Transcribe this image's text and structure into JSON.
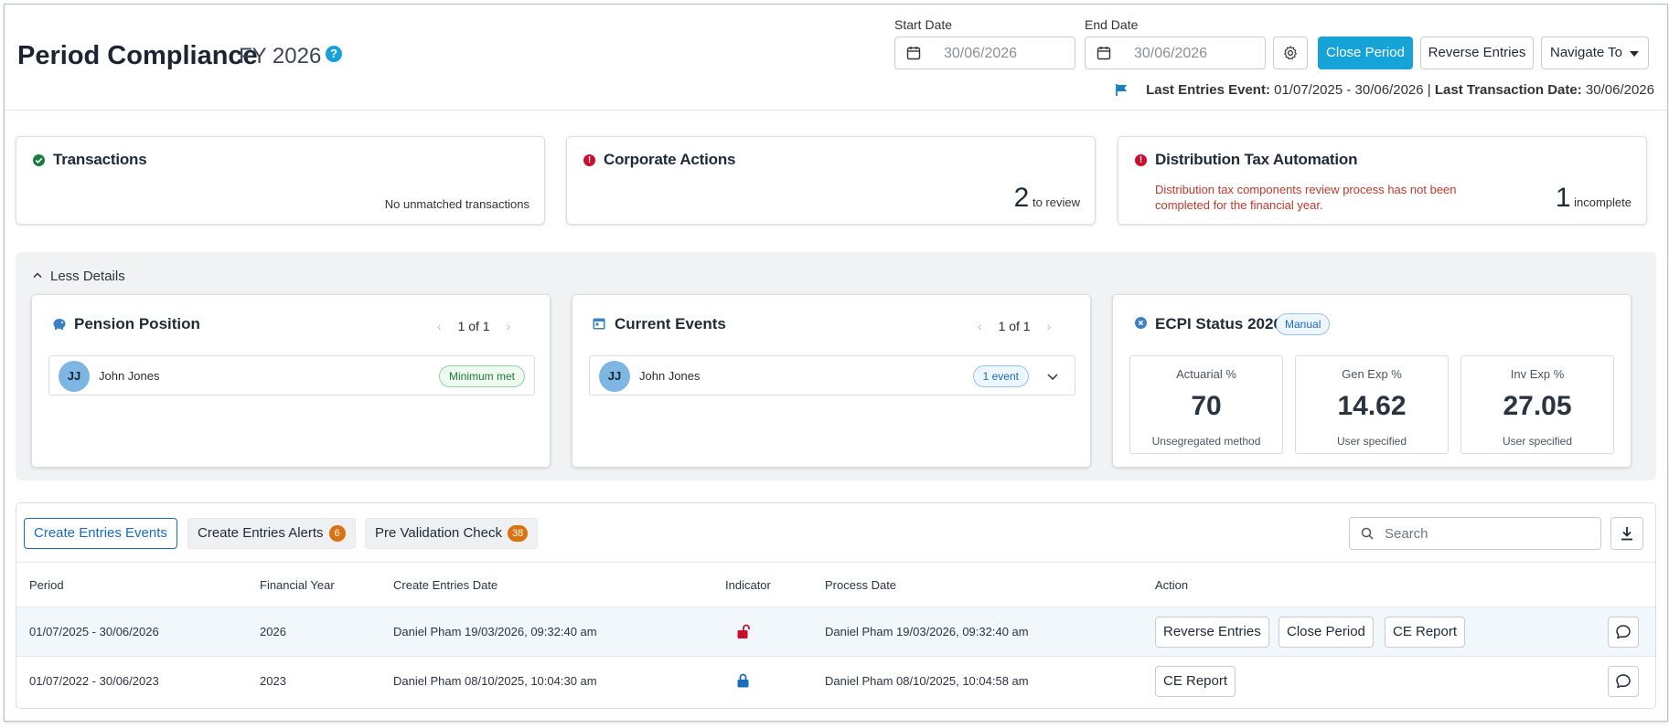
{
  "header": {
    "title": "Period Compliance",
    "subtitle": "FY 2026",
    "help_icon": "?",
    "start_date_label": "Start Date",
    "start_date_value": "30/06/2026",
    "end_date_label": "End Date",
    "end_date_value": "30/06/2026",
    "close_period_label": "Close Period",
    "reverse_entries_label": "Reverse Entries",
    "navigate_to_label": "Navigate To",
    "last_entries_event_label": "Last Entries Event:",
    "last_entries_event_value": "01/07/2025 - 30/06/2026",
    "separator": "|",
    "last_transaction_label": "Last Transaction Date:",
    "last_transaction_value": "30/06/2026"
  },
  "summary": {
    "transactions": {
      "title": "Transactions",
      "status_icon": "check-icon",
      "text": "No unmatched transactions"
    },
    "corporate_actions": {
      "title": "Corporate Actions",
      "status_icon": "alert-icon",
      "count": "2",
      "count_label": "to review"
    },
    "distribution_tax": {
      "title": "Distribution Tax Automation",
      "status_icon": "alert-icon",
      "warning": "Distribution tax components review process has not been completed for the financial year.",
      "count": "1",
      "count_label": "incomplete"
    }
  },
  "details": {
    "toggle_label": "Less Details",
    "pension": {
      "title": "Pension Position",
      "pager": "1 of 1",
      "person_initials": "JJ",
      "person_name": "John Jones",
      "badge": "Minimum met"
    },
    "events": {
      "title": "Current Events",
      "pager": "1 of 1",
      "person_initials": "JJ",
      "person_name": "John Jones",
      "badge": "1 event"
    },
    "ecpi": {
      "title": "ECPI Status 2026",
      "badge": "Manual",
      "metrics": [
        {
          "label": "Actuarial %",
          "value": "70",
          "sub": "Unsegregated method"
        },
        {
          "label": "Gen Exp %",
          "value": "14.62",
          "sub": "User specified"
        },
        {
          "label": "Inv Exp %",
          "value": "27.05",
          "sub": "User specified"
        }
      ]
    }
  },
  "tabs": [
    {
      "label": "Create Entries Events",
      "active": true
    },
    {
      "label": "Create Entries Alerts",
      "count": "6"
    },
    {
      "label": "Pre Validation Check",
      "count": "38"
    }
  ],
  "search": {
    "placeholder": "Search"
  },
  "table": {
    "columns": [
      "Period",
      "Financial Year",
      "Create Entries Date",
      "Indicator",
      "Process Date",
      "Action"
    ],
    "rows": [
      {
        "period": "01/07/2025 - 30/06/2026",
        "year": "2026",
        "created": "Daniel Pham 19/03/2026, 09:32:40 am",
        "indicator": "unlocked-icon",
        "processed": "Daniel Pham 19/03/2026, 09:32:40 am",
        "actions": [
          "Reverse Entries",
          "Close Period",
          "CE Report"
        ]
      },
      {
        "period": "01/07/2022 - 30/06/2023",
        "year": "2023",
        "created": "Daniel Pham 08/10/2025, 10:04:30 am",
        "indicator": "locked-icon",
        "processed": "Daniel Pham 08/10/2025, 10:04:58 am",
        "actions": [
          "CE Report"
        ]
      }
    ]
  },
  "colors": {
    "primary": "#16a3d8",
    "ok": "#1b7a3e",
    "error": "#c8102e",
    "badge_orange": "#d9720f",
    "link_blue": "#1a6bc0"
  }
}
